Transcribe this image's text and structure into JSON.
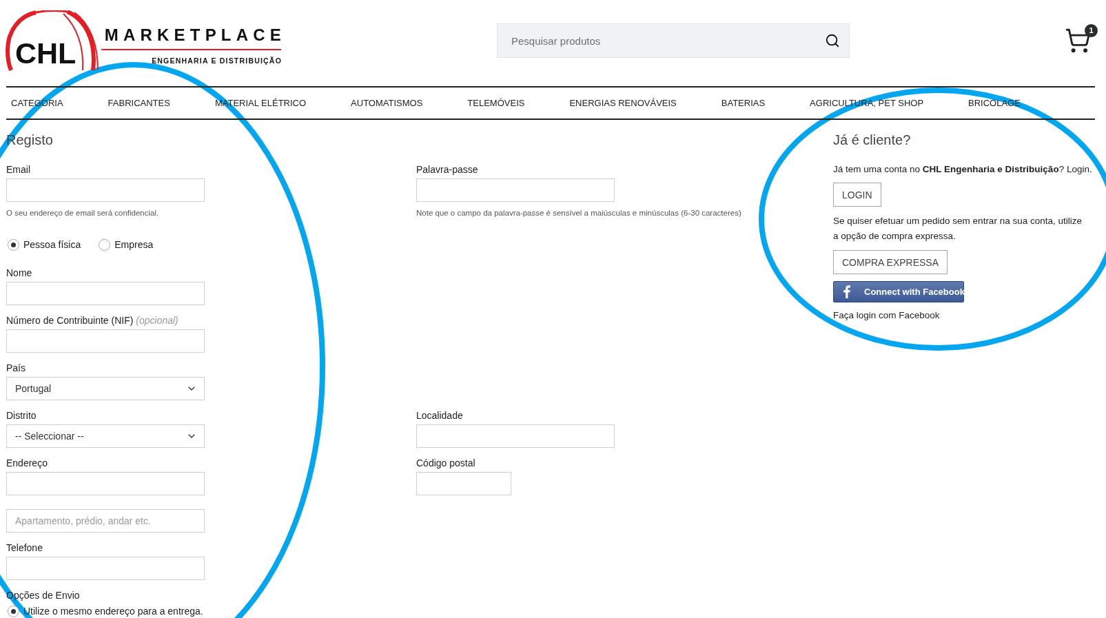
{
  "header": {
    "logo": {
      "initials": "CHL",
      "wordmark": "MARKETPLACE",
      "tagline": "ENGENHARIA E DISTRIBUIÇÃO"
    },
    "search": {
      "placeholder": "Pesquisar produtos"
    },
    "cart": {
      "count": "1"
    }
  },
  "nav": [
    "CATEGORIA",
    "FABRICANTES",
    "MATERIAL ELÉTRICO",
    "AUTOMATISMOS",
    "TELEMÓVEIS",
    "ENERGIAS RENOVÁVEIS",
    "BATERIAS",
    "AGRICULTURA, PET SHOP",
    "BRICOLAGE"
  ],
  "registration": {
    "title": "Registo",
    "rows": [
      {
        "cells": [
          {
            "kind": "text",
            "label": "Email",
            "hint": "O seu endereço de email será confidencial."
          },
          {
            "kind": "text",
            "label": "Palavra-passe",
            "hint": "Note que o campo da palavra-passe é sensível a maiúsculas e minúsculas (6-30 caracteres)"
          }
        ]
      },
      {
        "cells": [
          {
            "kind": "radio_group",
            "options": [
              {
                "label": "Pessoa física",
                "selected": true
              },
              {
                "label": "Empresa",
                "selected": false
              }
            ]
          }
        ]
      },
      {
        "cells": [
          {
            "kind": "text",
            "label": "Nome"
          }
        ]
      },
      {
        "cells": [
          {
            "kind": "text",
            "label": "Número de Contribuinte (NIF) *(opcional)*"
          }
        ]
      },
      {
        "cells": [
          {
            "kind": "select",
            "label": "País",
            "value": "Portugal"
          }
        ]
      },
      {
        "cells": [
          {
            "kind": "select",
            "label": "Distrito",
            "value": "-- Seleccionar --"
          },
          {
            "kind": "text",
            "label": "Localidade"
          }
        ]
      },
      {
        "cells": [
          {
            "kind": "text",
            "label": "Endereço"
          },
          {
            "kind": "short_text",
            "label": "Código postal"
          }
        ]
      },
      {
        "cells": [
          {
            "kind": "text",
            "placeholder": "Apartamento, prédio, andar etc."
          }
        ]
      },
      {
        "cells": [
          {
            "kind": "text",
            "label": "Telefone"
          }
        ]
      },
      {
        "cells": [
          {
            "kind": "radio_group",
            "label": "Opções de Envio",
            "options": [
              {
                "label": "Utilize o mesmo endereço para a entrega.",
                "selected": true
              }
            ]
          }
        ]
      }
    ]
  },
  "login_panel": {
    "title": "Já é cliente?",
    "intro": "Já tem uma conta no **CHL Engenharia e Distribuição**? Login.",
    "login_button": "LOGIN",
    "guest_text": "Se quiser efetuar um pedido sem entrar na sua conta, utilize a opção de compra expressa.",
    "guest_button": "COMPRA EXPRESSA",
    "facebook_button": "Connect with Facebook",
    "facebook_note": "Faça login com Facebook"
  },
  "annotations": [
    {
      "kind": "ellipse"
    },
    {
      "kind": "ellipse"
    }
  ]
}
